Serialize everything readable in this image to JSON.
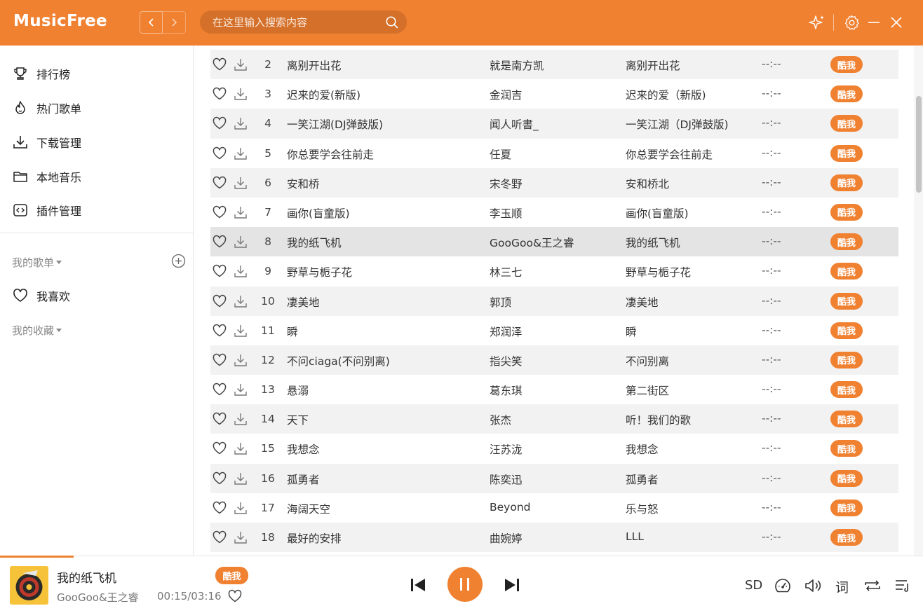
{
  "app": {
    "title": "MusicFree"
  },
  "header": {
    "search_placeholder": "在这里输入搜索内容"
  },
  "sidebar": {
    "items": [
      {
        "label": "排行榜",
        "icon": "trophy-icon"
      },
      {
        "label": "热门歌单",
        "icon": "fire-icon"
      },
      {
        "label": "下载管理",
        "icon": "download-icon"
      },
      {
        "label": "本地音乐",
        "icon": "folder-icon"
      },
      {
        "label": "插件管理",
        "icon": "code-icon"
      }
    ],
    "my_playlists_label": "我的歌单",
    "favorites_label": "我喜欢",
    "my_collection_label": "我的收藏"
  },
  "songs": [
    {
      "index": "2",
      "title": "离别开出花",
      "artist": "就是南方凯",
      "album": "离别开出花",
      "duration": "--:--",
      "source": "酷我"
    },
    {
      "index": "3",
      "title": "迟来的爱(新版)",
      "artist": "金润吉",
      "album": "迟来的爱（新版)",
      "duration": "--:--",
      "source": "酷我"
    },
    {
      "index": "4",
      "title": "一笑江湖(DJ弹鼓版)",
      "artist": "闻人听書_",
      "album": "一笑江湖（DJ弹鼓版)",
      "duration": "--:--",
      "source": "酷我"
    },
    {
      "index": "5",
      "title": "你总要学会往前走",
      "artist": "任夏",
      "album": "你总要学会往前走",
      "duration": "--:--",
      "source": "酷我"
    },
    {
      "index": "6",
      "title": "安和桥",
      "artist": "宋冬野",
      "album": "安和桥北",
      "duration": "--:--",
      "source": "酷我"
    },
    {
      "index": "7",
      "title": "画你(盲童版)",
      "artist": "李玉顺",
      "album": "画你(盲童版)",
      "duration": "--:--",
      "source": "酷我"
    },
    {
      "index": "8",
      "title": "我的纸飞机",
      "artist": "GooGoo&王之睿",
      "album": "我的纸飞机",
      "duration": "--:--",
      "source": "酷我"
    },
    {
      "index": "9",
      "title": "野草与栀子花",
      "artist": "林三七",
      "album": "野草与栀子花",
      "duration": "--:--",
      "source": "酷我"
    },
    {
      "index": "10",
      "title": "凄美地",
      "artist": "郭顶",
      "album": "凄美地",
      "duration": "--:--",
      "source": "酷我"
    },
    {
      "index": "11",
      "title": "瞬",
      "artist": "郑润泽",
      "album": "瞬",
      "duration": "--:--",
      "source": "酷我"
    },
    {
      "index": "12",
      "title": "不问ciaga(不问别离)",
      "artist": "指尖笑",
      "album": "不问别离",
      "duration": "--:--",
      "source": "酷我"
    },
    {
      "index": "13",
      "title": "悬溺",
      "artist": "葛东琪",
      "album": "第二街区",
      "duration": "--:--",
      "source": "酷我"
    },
    {
      "index": "14",
      "title": "天下",
      "artist": "张杰",
      "album": "听！我们的歌",
      "duration": "--:--",
      "source": "酷我"
    },
    {
      "index": "15",
      "title": "我想念",
      "artist": "汪苏泷",
      "album": "我想念",
      "duration": "--:--",
      "source": "酷我"
    },
    {
      "index": "16",
      "title": "孤勇者",
      "artist": "陈奕迅",
      "album": "孤勇者",
      "duration": "--:--",
      "source": "酷我"
    },
    {
      "index": "17",
      "title": "海阔天空",
      "artist": "Beyond",
      "album": "乐与怒",
      "duration": "--:--",
      "source": "酷我"
    },
    {
      "index": "18",
      "title": "最好的安排",
      "artist": "曲婉婷",
      "album": "LLL",
      "duration": "--:--",
      "source": "酷我"
    }
  ],
  "active_song_index": "8",
  "player": {
    "title": "我的纸飞机",
    "artist": "GooGoo&王之睿",
    "time": "00:15/03:16",
    "source": "酷我",
    "progress_percent": 8,
    "quality": "SD",
    "lyrics_label": "词"
  },
  "colors": {
    "accent": "#f08131",
    "row_alt": "#f2f2f2",
    "row_active": "#e4e4e4"
  }
}
